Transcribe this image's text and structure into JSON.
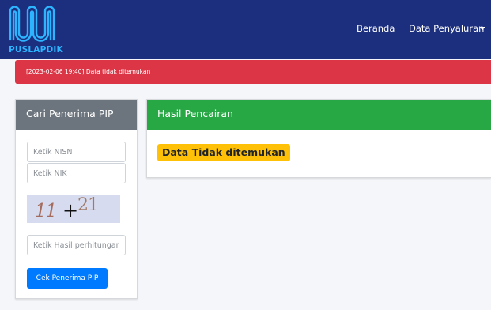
{
  "brand": {
    "name": "PUSLAPDIK",
    "logo_icon": "puslapdik-logo-icon",
    "color": "#2db4ff"
  },
  "nav": {
    "home_label": "Beranda",
    "data_label": "Data Penyaluran",
    "background": "#1c2f7e"
  },
  "alert": {
    "message": "[2023-02-06 19:40] Data tidak ditemukan",
    "color": "#dc3545"
  },
  "search": {
    "title": "Cari Penerima PIP",
    "nisn_placeholder": "Ketik NISN",
    "nik_placeholder": "Ketik NIK",
    "captcha": {
      "left": "11",
      "operator": "+",
      "right": "21"
    },
    "answer_placeholder": "Ketik Hasil perhitungan",
    "submit_label": "Cek Penerima PIP",
    "header_color": "#6c757d",
    "button_color": "#007bff"
  },
  "results": {
    "title": "Hasil Pencairan",
    "status_badge": "Data Tidak ditemukan",
    "header_color": "#28a745",
    "badge_color": "#ffc107"
  }
}
